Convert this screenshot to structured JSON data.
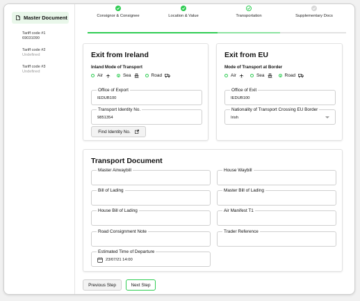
{
  "sidebar": {
    "master_document": "Master Document",
    "tariffs": [
      {
        "title": "Tariff code #1",
        "value": "69031090",
        "undefined": false
      },
      {
        "title": "Tariff code #2",
        "value": "Undefined",
        "undefined": true
      },
      {
        "title": "Tariff code #3",
        "value": "Undefined",
        "undefined": true
      }
    ]
  },
  "steps": [
    {
      "label": "Consignor & Consignee",
      "state": "done"
    },
    {
      "label": "Location & Value",
      "state": "done"
    },
    {
      "label": "Transportation",
      "state": "current"
    },
    {
      "label": "Supplementary Docs",
      "state": "todo"
    }
  ],
  "exit_ireland": {
    "title": "Exit from Ireland",
    "mode_label": "Inland Mode of Transport",
    "modes": [
      {
        "label": "Air",
        "icon": "airplane-icon",
        "selected": false
      },
      {
        "label": "Sea",
        "icon": "ship-icon",
        "selected": true
      },
      {
        "label": "Road",
        "icon": "truck-icon",
        "selected": false
      }
    ],
    "office_label": "Office of Export",
    "office_value": "IEDUB100",
    "identity_label": "Transport Identity No.",
    "identity_value": "9851354",
    "find_button": "Find Identity No."
  },
  "exit_eu": {
    "title": "Exit from EU",
    "mode_label": "Mode of Transport at Border",
    "modes": [
      {
        "label": "Air",
        "icon": "airplane-icon",
        "selected": false
      },
      {
        "label": "Sea",
        "icon": "ship-icon",
        "selected": false
      },
      {
        "label": "Road",
        "icon": "truck-icon",
        "selected": true
      }
    ],
    "office_label": "Office of Exit",
    "office_value": "IEDUB100",
    "nationality_label": "Nationality of Transport Crossing EU Border",
    "nationality_value": "Irish"
  },
  "transport_doc": {
    "title": "Transport Document",
    "fields": {
      "master_airwaybill": "Master Airwaybill",
      "house_waybill": "House Waybill",
      "bill_of_lading": "Bill of Lading",
      "master_bill_of_lading": "Master Bill of Lading",
      "house_bill_of_lading": "House Bill of Lading",
      "air_manifest": "Air Manifest T1",
      "road_consignment": "Road Consignment Note",
      "trader_reference": "Trader Reference"
    },
    "departure_label": "Estimated Time of Departure",
    "departure_value": "23/07/21 14:00"
  },
  "footer": {
    "previous": "Previous Step",
    "next": "Next Step"
  },
  "colors": {
    "accent": "#2ecc52",
    "accent_light": "#e9f7ea",
    "inactive": "#d8d8d8"
  }
}
